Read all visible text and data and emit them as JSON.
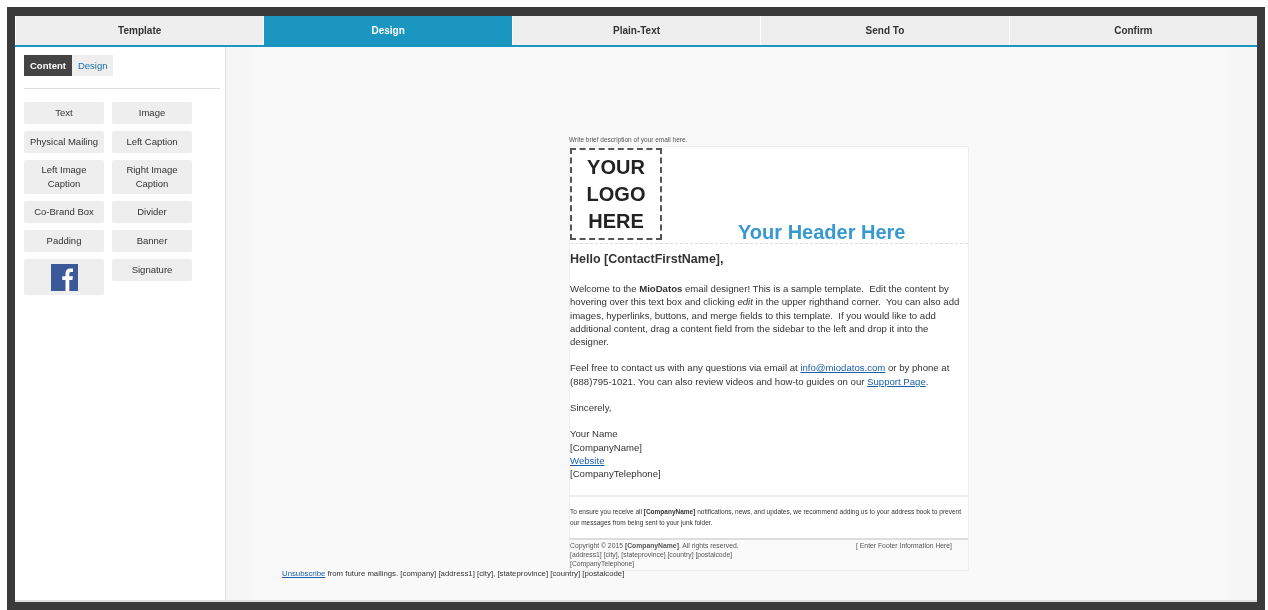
{
  "wizard_tabs": [
    {
      "label": "Template",
      "selected": false
    },
    {
      "label": "Design",
      "selected": true
    },
    {
      "label": "Plain-Text",
      "selected": false
    },
    {
      "label": "Send To",
      "selected": false
    },
    {
      "label": "Confirm",
      "selected": false
    }
  ],
  "sidebar": {
    "mode_tabs": [
      {
        "label": "Content",
        "selected": true
      },
      {
        "label": "Design",
        "selected": false
      }
    ],
    "blocks": [
      {
        "kind": "text",
        "label": "Text"
      },
      {
        "kind": "text",
        "label": "Image"
      },
      {
        "kind": "text",
        "label": "Physical Mailing"
      },
      {
        "kind": "text",
        "label": "Left Caption"
      },
      {
        "kind": "text",
        "label": "Left Image Caption"
      },
      {
        "kind": "text",
        "label": "Right Image Caption"
      },
      {
        "kind": "text",
        "label": "Co-Brand Box"
      },
      {
        "kind": "text",
        "label": "Divider"
      },
      {
        "kind": "text",
        "label": "Padding"
      },
      {
        "kind": "text",
        "label": "Banner"
      },
      {
        "kind": "facebook"
      },
      {
        "kind": "text",
        "label": "Signature"
      }
    ]
  },
  "email": {
    "description": "Write brief description of your email here.",
    "logo_lines": [
      "YOUR",
      "LOGO",
      "HERE"
    ],
    "header": "Your Header Here",
    "greeting": "Hello [ContactFirstName],",
    "paragraphs": [
      [
        {
          "kind": "text",
          "text": "Welcome to the **MioDatos** email designer! This is a sample template.  Edit the content by hovering over this text box and clicking *edit* in the upper righthand corner.  You can also add images, hyperlinks, buttons, and merge fields to this template.  If you would like to add additional content, drag a content field from the sidebar to the left and drop it into the designer."
        }
      ],
      [
        {
          "kind": "text",
          "text": "Feel free to contact us with any questions via email at "
        },
        {
          "kind": "link",
          "text": "info@miodatos.com"
        },
        {
          "kind": "text",
          "text": " or by phone at (888)795-1021. You can also review videos and how-to guides on our "
        },
        {
          "kind": "link",
          "text": "Support Page"
        },
        {
          "kind": "text",
          "text": "."
        }
      ],
      [
        {
          "kind": "text",
          "text": "Sincerely,"
        }
      ]
    ],
    "signature": [
      {
        "kind": "text",
        "text": "Your Name"
      },
      {
        "kind": "text",
        "text": "[CompanyName]"
      },
      {
        "kind": "link",
        "text": "Website"
      },
      {
        "kind": "text",
        "text": "[CompanyTelephone]"
      }
    ],
    "notice": "To ensure you receive all **[CompanyName]** notifications, news, and updates, we recommend adding us to your address book to prevent our messages from being sent to your junk folder.",
    "copyright": "Copyright © 2015 **[CompanyName]**. All rights reserved.",
    "footer_info": "[ Enter Footer Information Here]",
    "address": "[address1] [city], [stateprovince] [country] [postalcode]",
    "telephone": "[CompanyTelephone]"
  },
  "unsubscribe": {
    "link": "Unsubscribe",
    "text": "from future mailings. [company] [address1] [city], [stateprovince] [country] [postalcode]"
  }
}
